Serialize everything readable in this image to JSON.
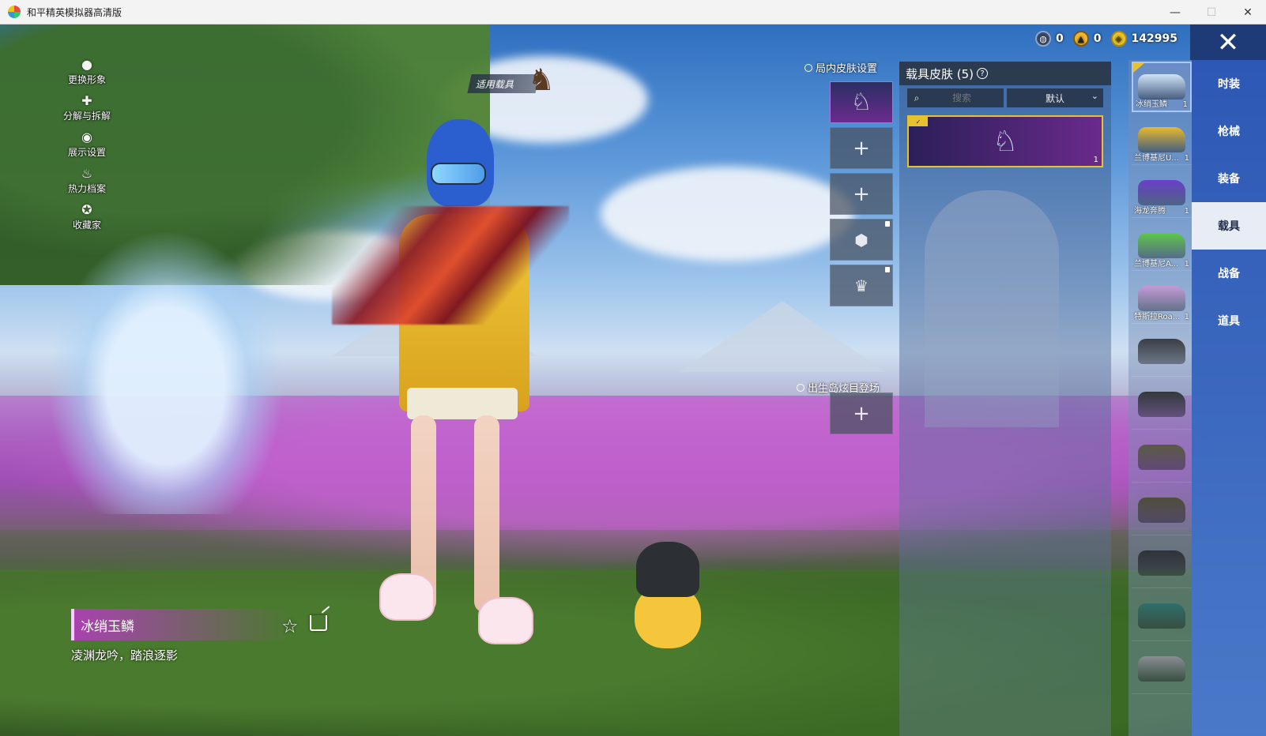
{
  "window": {
    "title": "和平精英模拟器高清版",
    "minimize": "—",
    "maximize": "☐",
    "close": "✕"
  },
  "side_menu": [
    {
      "label": "更换形象",
      "icon": "person-icon"
    },
    {
      "label": "分解与拆解",
      "icon": "puzzle-icon"
    },
    {
      "label": "展示设置",
      "icon": "eye-icon"
    },
    {
      "label": "热力档案",
      "icon": "flame-icon"
    },
    {
      "label": "收藏家",
      "icon": "collector-badge-icon"
    }
  ],
  "apply_vehicle": "适用载具",
  "currencies": [
    {
      "value": "0",
      "icon": "globe-coin-icon"
    },
    {
      "value": "0",
      "icon": "gold-coin-icon"
    },
    {
      "value": "142995",
      "icon": "token-coin-icon"
    }
  ],
  "skin_settings_label": "局内皮肤设置",
  "spawn_label": "出生岛炫目登场",
  "vehicle_panel": {
    "title": "载具皮肤 (5)",
    "search_placeholder": "搜索",
    "sort_label": "默认",
    "card_badge": "✓",
    "card_count": "1"
  },
  "vehicle_list": [
    {
      "name": "冰绡玉鳞",
      "count": "1",
      "color": "#cfe4f7"
    },
    {
      "name": "兰博基尼U...",
      "count": "1",
      "color": "#e8b92e"
    },
    {
      "name": "海龙奔腾",
      "count": "1",
      "color": "#6a3fc8"
    },
    {
      "name": "兰博基尼A...",
      "count": "1",
      "color": "#5fc84a"
    },
    {
      "name": "特斯拉Roa...",
      "count": "1",
      "color": "#c59ad6"
    },
    {
      "name": "",
      "count": "",
      "color": "#3b3e44"
    },
    {
      "name": "",
      "count": "",
      "color": "#33363c"
    },
    {
      "name": "",
      "count": "",
      "color": "#5a5a44"
    },
    {
      "name": "",
      "count": "",
      "color": "#4e4e3a"
    },
    {
      "name": "",
      "count": "",
      "color": "#2e3338"
    },
    {
      "name": "",
      "count": "",
      "color": "#2f6f6a"
    },
    {
      "name": "",
      "count": "",
      "color": "#8a8e94"
    }
  ],
  "tabs": [
    "时装",
    "枪械",
    "装备",
    "载具",
    "战备",
    "道具"
  ],
  "active_tab": "载具",
  "selected_skin": {
    "name": "冰绡玉鳞",
    "description": "凌渊龙吟，踏浪逐影"
  }
}
